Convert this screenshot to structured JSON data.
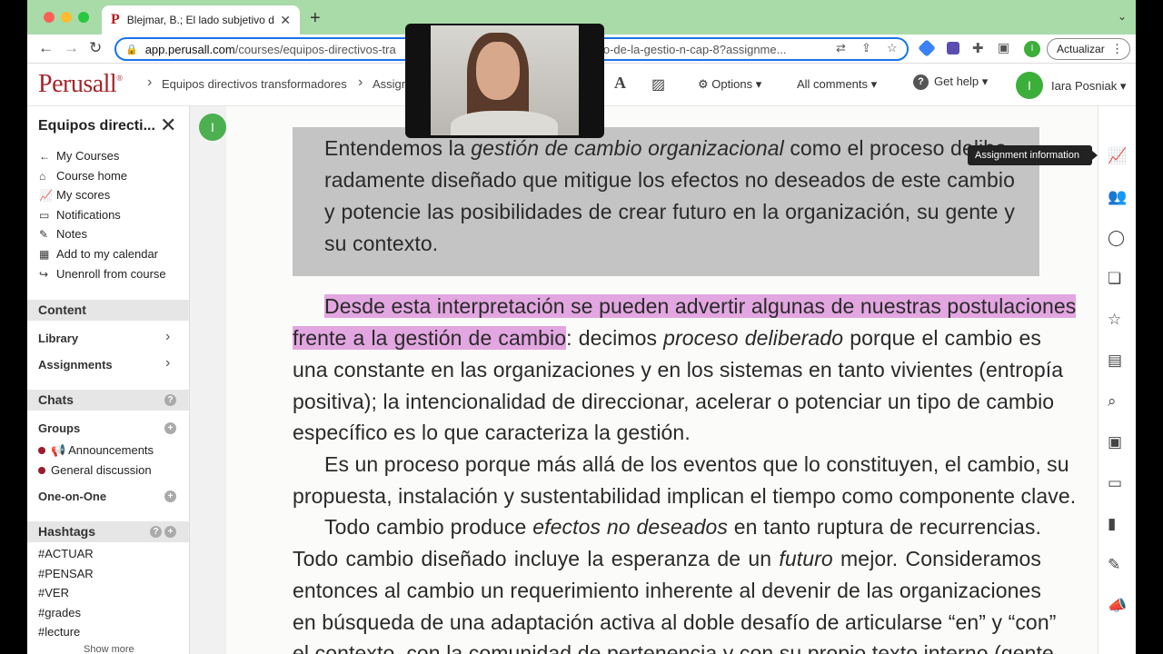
{
  "browser": {
    "tab_title": "Blejmar, B.; El lado subjetivo de",
    "tab_favicon": "P",
    "tab_close": "✕",
    "new_tab": "+",
    "tab_menu": "⌄",
    "url_host": "app.perusall.com",
    "url_path_start": "/courses/equipos-directivos-tra",
    "url_path_end": "jetivo-de-la-gestio-n-cap-8?assignme...",
    "update_button": "Actualizar",
    "profile_initial": "I"
  },
  "header": {
    "logo": "Perusall",
    "logo_mark": "®",
    "breadcrumb_course": "Equipos directivos transformadores",
    "breadcrumb_assignment": "Assign",
    "options_menu": "Options",
    "comments_filter": "All comments",
    "help_menu": "Get help",
    "user_initial": "I",
    "user_name": "Iara Posniak"
  },
  "sidebar": {
    "title": "Equipos directi...",
    "links": [
      {
        "icon": "arrow-left-icon",
        "label": "My Courses"
      },
      {
        "icon": "home-icon",
        "label": "Course home"
      },
      {
        "icon": "chart-icon",
        "label": "My scores"
      },
      {
        "icon": "notification-icon",
        "label": "Notifications"
      },
      {
        "icon": "pencil-icon",
        "label": "Notes"
      },
      {
        "icon": "calendar-icon",
        "label": "Add to my calendar"
      },
      {
        "icon": "exit-icon",
        "label": "Unenroll from course"
      }
    ],
    "content_section": "Content",
    "library": "Library",
    "assignments": "Assignments",
    "chats_section": "Chats",
    "groups": "Groups",
    "chats": [
      "Announcements",
      "General discussion"
    ],
    "one_on_one": "One-on-One",
    "hashtags_section": "Hashtags",
    "hashtags": [
      "#ACTUAR",
      "#PENSAR",
      "#VER",
      "#grades",
      "#lecture"
    ],
    "show_more": "Show more"
  },
  "document": {
    "annotation_avatar": "I",
    "quote_box": [
      {
        "parts": [
          {
            "t": "Entendemos la "
          },
          {
            "t": "gestión de cambio organizacional",
            "i": true
          },
          {
            "t": " como el proceso delibe-"
          }
        ]
      },
      {
        "parts": [
          {
            "t": "radamente diseñado que mitigue los efectos no deseados de este cambio"
          }
        ]
      },
      {
        "parts": [
          {
            "t": "y potencie las posibilidades de crear futuro en la organización, su gente y"
          }
        ]
      },
      {
        "parts": [
          {
            "t": "su contexto."
          }
        ]
      }
    ],
    "body": [
      {
        "parts": [
          {
            "t": "Desde esta interpretación se pueden advertir algunas de nuestras postulaciones",
            "h": true
          }
        ]
      },
      {
        "parts": [
          {
            "t": "frente a la gestión de cambio",
            "h": true
          },
          {
            "t": ": decimos "
          },
          {
            "t": "proceso deliberado",
            "i": true
          },
          {
            "t": " porque el cambio es"
          }
        ]
      },
      {
        "parts": [
          {
            "t": "una constante en las organizaciones y en los sistemas en tanto vivientes (entropía"
          }
        ]
      },
      {
        "parts": [
          {
            "t": "positiva); la intencionalidad de direccionar, acelerar o potenciar un tipo de cambio"
          }
        ]
      },
      {
        "parts": [
          {
            "t": "específico es lo que caracteriza la gestión."
          }
        ]
      },
      {
        "parts": [
          {
            "t": "Es un proceso porque más allá de los eventos que lo constituyen, el cambio, su"
          }
        ]
      },
      {
        "parts": [
          {
            "t": "propuesta, instalación y sustentabilidad implican el tiempo como componente clave."
          }
        ]
      },
      {
        "parts": [
          {
            "t": "Todo cambio produce "
          },
          {
            "t": "efectos no deseados",
            "i": true
          },
          {
            "t": " en tanto ruptura de recurrencias."
          }
        ]
      },
      {
        "parts": [
          {
            "t": "Todo cambio diseñado incluye la esperanza de un "
          },
          {
            "t": "futuro",
            "i": true
          },
          {
            "t": " mejor. Consideramos"
          }
        ]
      },
      {
        "parts": [
          {
            "t": "entonces al cambio un requerimiento inherente al devenir de las organizaciones"
          }
        ]
      },
      {
        "parts": [
          {
            "t": "en búsqueda de una adaptación activa al doble desafío de articularse “en” y “con”"
          }
        ]
      },
      {
        "parts": [
          {
            "t": "el contexto, con la comunidad de pertenencia y con su propio texto interno (gente,"
          }
        ]
      }
    ]
  },
  "right_rail": {
    "tooltip": "Assignment information",
    "icons": [
      "chart-line-icon",
      "people-icon",
      "comment-icon",
      "comments-icon",
      "star-icon",
      "document-icon",
      "search-icon",
      "assignment-icon",
      "inbox-icon",
      "bookmark-icon",
      "pen-icon",
      "megaphone-icon"
    ]
  },
  "colors": {
    "highlight": "#e2a6e0",
    "brand": "#a4262c",
    "avatar_green": "#3cae3a",
    "tab_strip": "#a8dba8",
    "chat_dot": "#9a1b2c"
  }
}
